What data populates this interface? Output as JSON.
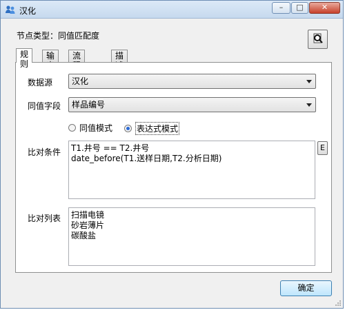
{
  "window": {
    "title": "汉化",
    "icon": "users-icon",
    "controls": {
      "minimize": "–",
      "maximize": "□",
      "close": "✕"
    }
  },
  "node_type": "节点类型：同值匹配度",
  "preview_icon": "search-doc-icon",
  "tabs": [
    "规则",
    "输出",
    "流程参数",
    "描述"
  ],
  "form": {
    "datasource_label": "数据源",
    "datasource_value": "汉化",
    "field_label": "同值字段",
    "field_value": "样品编号",
    "mode_options": [
      "同值模式",
      "表达式模式"
    ],
    "mode_selected": "表达式模式",
    "condition_label": "比对条件",
    "condition_lines": [
      "T1.井号 == T2.井号",
      "date_before(T1.送样日期,T2.分析日期)"
    ],
    "expr_button": "E",
    "list_label": "比对列表",
    "list_items": [
      "扫描电镜",
      "砂岩薄片",
      "碳酸盐"
    ]
  },
  "ok_button": "确定",
  "colors": {
    "titlebar": "#c6d9ee",
    "close": "#c7402a",
    "accent": "#2a6ad6"
  }
}
